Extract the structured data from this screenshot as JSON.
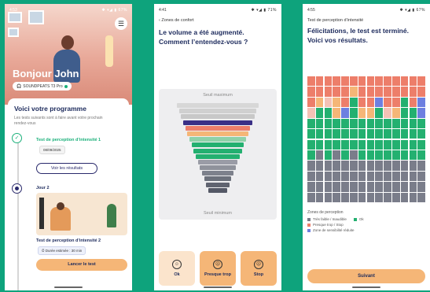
{
  "screen1": {
    "status": {
      "time": "4:53",
      "icons": "✱ ▾◢ ▮ 67%"
    },
    "greeting": "Bonjour John",
    "device": "SOUNDPEATS T3 Pro",
    "program_title": "Voici votre programme",
    "program_sub": "Les tests suivants sont à faire avant votre prochain rendez-vous",
    "test1": {
      "title": "Test de perception d’intensité 1",
      "date": "08/09/2025",
      "button": "Voir les résultats"
    },
    "step2": {
      "label": "Jour 2",
      "title": "Test de perception d’intensité 2",
      "duration": "⏱ Durée estimée : 30 min",
      "button": "Lancer le test"
    }
  },
  "screen2": {
    "status": {
      "time": "4:41",
      "icons": "✱ ▾◢ ▮ 71%"
    },
    "back": "Zones de confort",
    "title": "Le volume a été augmenté. Comment l’entendez-vous ?",
    "seuil_max": "Seuil maximum",
    "seuil_min": "Seuil minimum",
    "levels": [
      {
        "color": "#d7d7d7"
      },
      {
        "color": "#d0d0d0"
      },
      {
        "color": "#c8c8c8"
      },
      {
        "color": "#3a2f86"
      },
      {
        "color": "#ed7e6a"
      },
      {
        "color": "#f5b677"
      },
      {
        "color": "#8fd1a9"
      },
      {
        "color": "#23b070"
      },
      {
        "color": "#23b070"
      },
      {
        "color": "#23b070"
      },
      {
        "color": "#9a9ca6"
      },
      {
        "color": "#8f929b"
      },
      {
        "color": "#7d818c"
      },
      {
        "color": "#6c717c"
      },
      {
        "color": "#5f6370"
      },
      {
        "color": "#545866"
      }
    ],
    "answers": [
      {
        "label": "Ok",
        "face": "☺"
      },
      {
        "label": "Presque trop",
        "face": "☹"
      },
      {
        "label": "Stop",
        "face": "☹"
      }
    ]
  },
  "screen3": {
    "status": {
      "time": "4:55",
      "icons": "✱ ▾◢ ▮ 67%"
    },
    "header": "Test de perception d’intensité",
    "title": "Félicitations, le test est terminé. Voici vos résultats.",
    "legend_title": "Zones de perception",
    "legend": [
      {
        "label": "Très faible / Inaudible",
        "color": "#7a7d8a"
      },
      {
        "label": "Ok",
        "color": "#23b070"
      },
      {
        "label": "Presque trop / Stop",
        "color": "#ed7e6a"
      },
      {
        "label": "Zone de sensibilité réduite",
        "color": "#6d7fe0"
      }
    ],
    "button": "Suivant",
    "columns": [
      [
        "R",
        "R",
        "R",
        "P",
        "G",
        "G",
        "G",
        "G",
        "A",
        "A",
        "A",
        "A"
      ],
      [
        "R",
        "R",
        "O",
        "G",
        "G",
        "G",
        "G",
        "A",
        "A",
        "A",
        "A",
        "A"
      ],
      [
        "R",
        "R",
        "P",
        "G",
        "G",
        "G",
        "G",
        "G",
        "A",
        "A",
        "A",
        "A"
      ],
      [
        "R",
        "R",
        "O",
        "O",
        "G",
        "G",
        "G",
        "A",
        "A",
        "A",
        "A",
        "A"
      ],
      [
        "R",
        "R",
        "R",
        "B",
        "G",
        "G",
        "G",
        "G",
        "A",
        "A",
        "A",
        "A"
      ],
      [
        "R",
        "O",
        "G",
        "G",
        "G",
        "G",
        "G",
        "A",
        "A",
        "A",
        "A",
        "A"
      ],
      [
        "R",
        "R",
        "R",
        "O",
        "G",
        "G",
        "G",
        "G",
        "A",
        "A",
        "A",
        "A"
      ],
      [
        "R",
        "R",
        "R",
        "O",
        "G",
        "G",
        "G",
        "G",
        "A",
        "A",
        "A",
        "A"
      ],
      [
        "R",
        "R",
        "B",
        "G",
        "G",
        "G",
        "G",
        "G",
        "A",
        "A",
        "A",
        "A"
      ],
      [
        "R",
        "R",
        "R",
        "P",
        "G",
        "G",
        "G",
        "G",
        "A",
        "A",
        "A",
        "A"
      ],
      [
        "R",
        "R",
        "R",
        "O",
        "G",
        "G",
        "G",
        "G",
        "A",
        "A",
        "A",
        "A"
      ],
      [
        "R",
        "R",
        "G",
        "G",
        "G",
        "G",
        "G",
        "G",
        "A",
        "A",
        "A",
        "A"
      ],
      [
        "R",
        "R",
        "R",
        "G",
        "G",
        "G",
        "G",
        "G",
        "A",
        "A",
        "A",
        "A"
      ],
      [
        "R",
        "R",
        "B",
        "B",
        "G",
        "G",
        "G",
        "G",
        "A",
        "A",
        "A",
        "A"
      ]
    ],
    "cell_colors": {
      "R": "#ed7e6a",
      "O": "#f5b677",
      "P": "#f4c2b6",
      "G": "#23b070",
      "A": "#7a7d8a",
      "B": "#6d7fe0"
    }
  }
}
